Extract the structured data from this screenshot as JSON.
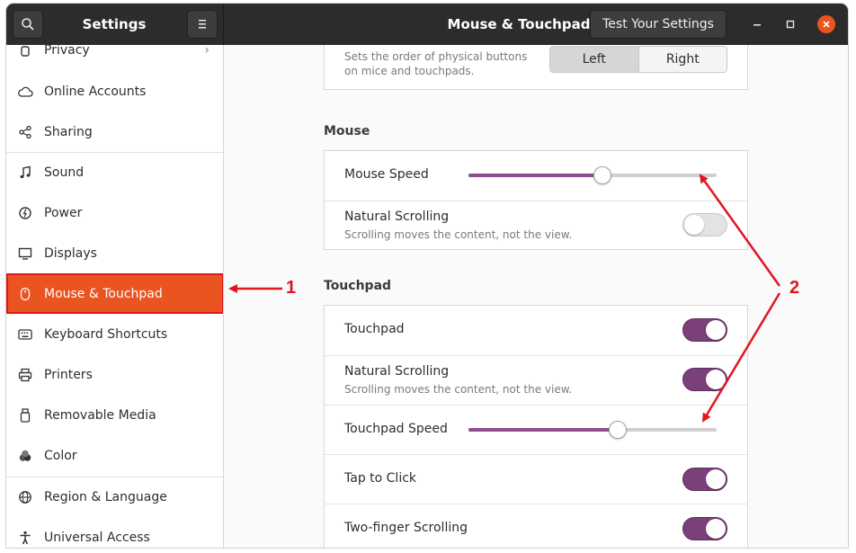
{
  "header": {
    "sidebar_title": "Settings",
    "panel_title": "Mouse & Touchpad",
    "test_button": "Test Your Settings",
    "icons": [
      "search-icon",
      "menu-icon",
      "minimize-icon",
      "maximize-icon",
      "close-icon"
    ]
  },
  "sidebar": {
    "items": [
      {
        "label": "Privacy",
        "icon": "hand-icon"
      },
      {
        "label": "Online Accounts",
        "icon": "cloud-icon"
      },
      {
        "label": "Sharing",
        "icon": "share-icon"
      },
      {
        "label": "Sound",
        "icon": "music-note-icon"
      },
      {
        "label": "Power",
        "icon": "power-icon"
      },
      {
        "label": "Displays",
        "icon": "display-icon"
      },
      {
        "label": "Mouse & Touchpad",
        "icon": "mouse-icon",
        "selected": true
      },
      {
        "label": "Keyboard Shortcuts",
        "icon": "keyboard-icon"
      },
      {
        "label": "Printers",
        "icon": "printer-icon"
      },
      {
        "label": "Removable Media",
        "icon": "usb-icon"
      },
      {
        "label": "Color",
        "icon": "color-icon"
      },
      {
        "label": "Region & Language",
        "icon": "globe-icon"
      },
      {
        "label": "Universal Access",
        "icon": "accessibility-icon"
      }
    ]
  },
  "general": {
    "primary_button_desc_line1": "Sets the order of physical buttons",
    "primary_button_desc_line2": "on mice and touchpads.",
    "left_option": "Left",
    "right_option": "Right",
    "selected": "Left"
  },
  "mouse": {
    "section_title": "Mouse",
    "speed_label": "Mouse Speed",
    "speed_value": 0.54,
    "natural_scrolling_label": "Natural Scrolling",
    "natural_scrolling_desc": "Scrolling moves the content, not the view.",
    "natural_scrolling_on": false
  },
  "touchpad": {
    "section_title": "Touchpad",
    "touchpad_label": "Touchpad",
    "touchpad_on": true,
    "natural_scrolling_label": "Natural Scrolling",
    "natural_scrolling_desc": "Scrolling moves the content, not the view.",
    "natural_scrolling_on": true,
    "speed_label": "Touchpad Speed",
    "speed_value": 0.6,
    "tap_to_click_label": "Tap to Click",
    "tap_to_click_on": true,
    "two_finger_label": "Two-finger Scrolling",
    "two_finger_on": true
  },
  "annotations": {
    "label_1": "1",
    "label_2": "2",
    "color": "#e0161e"
  },
  "colors": {
    "accent": "#e95420",
    "toggle_on": "#7b3f7a",
    "slider_fill": "#8e4d8c"
  }
}
